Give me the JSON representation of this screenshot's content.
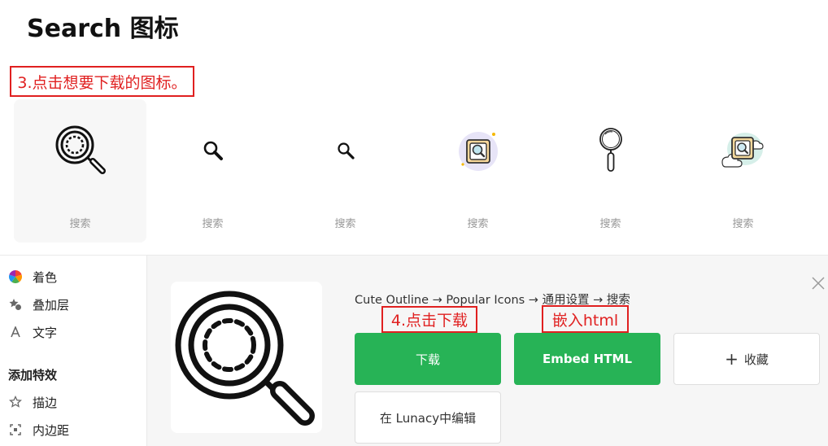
{
  "page": {
    "title": "Search 图标"
  },
  "annotations": {
    "step3": "3.点击想要下载的图标。",
    "step4": "4.点击下载",
    "embed": "嵌入html"
  },
  "icons": [
    {
      "caption": "搜索",
      "icon": "search-outline-large-icon",
      "selected": true
    },
    {
      "caption": "搜索",
      "icon": "search-glyph-icon"
    },
    {
      "caption": "搜索",
      "icon": "search-glyph-small-icon"
    },
    {
      "caption": "搜索",
      "icon": "search-color-frame-icon"
    },
    {
      "caption": "搜索",
      "icon": "search-magnifier-vertical-icon"
    },
    {
      "caption": "搜索",
      "icon": "search-cloud-frame-icon"
    }
  ],
  "sidebar": {
    "items": [
      {
        "label": "着色",
        "icon": "color-wheel-icon"
      },
      {
        "label": "叠加层",
        "icon": "overlay-icon"
      },
      {
        "label": "文字",
        "icon": "text-icon"
      }
    ],
    "heading": "添加特效",
    "effects": [
      {
        "label": "描边",
        "icon": "star-outline-icon"
      },
      {
        "label": "内边距",
        "icon": "padding-icon"
      }
    ]
  },
  "detail": {
    "breadcrumb": "Cute Outline → Popular Icons → 通用设置 → 搜索",
    "buttons": {
      "download": "下载",
      "embed": "Embed HTML",
      "favorite": "收藏",
      "favorite_prefix": "+",
      "lunacy": "在 Lunacy中编辑"
    }
  },
  "colors": {
    "accent": "#27b356",
    "annotation": "#e02020"
  }
}
